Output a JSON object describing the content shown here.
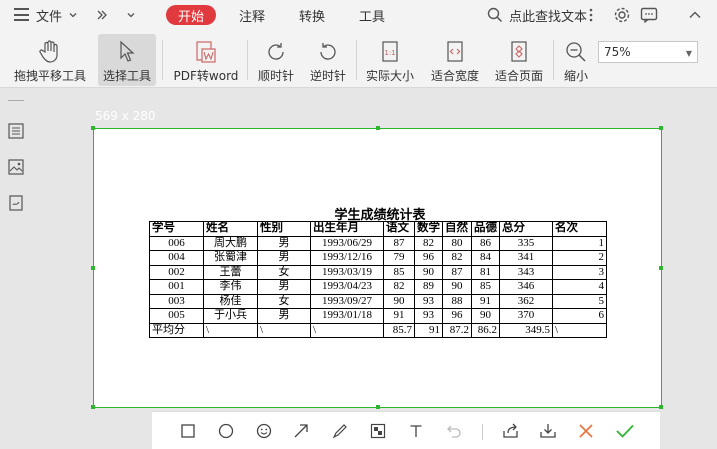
{
  "menubar": {
    "file": "文件",
    "tabs": [
      "开始",
      "注释",
      "转换",
      "工具"
    ],
    "search_label": "点此查找文本"
  },
  "ribbon": {
    "tools": [
      "拖拽平移工具",
      "选择工具",
      "PDF转word",
      "顺时针",
      "逆时针",
      "实际大小",
      "适合宽度",
      "适合页面",
      "缩小"
    ],
    "zoom_value": "75%"
  },
  "selection": {
    "size_label": "569 x 280"
  },
  "document": {
    "title": "学生成绩统计表",
    "headers": [
      "学号",
      "姓名",
      "性别",
      "出生年月",
      "语文",
      "数学",
      "自然",
      "品德",
      "总分",
      "名次"
    ],
    "rows": [
      [
        "006",
        "周大鹏",
        "男",
        "1993/06/29",
        "87",
        "82",
        "80",
        "86",
        "335",
        "1"
      ],
      [
        "004",
        "张蜀津",
        "男",
        "1993/12/16",
        "79",
        "96",
        "82",
        "84",
        "341",
        "2"
      ],
      [
        "002",
        "王蕾",
        "女",
        "1993/03/19",
        "85",
        "90",
        "87",
        "81",
        "343",
        "3"
      ],
      [
        "001",
        "李伟",
        "男",
        "1993/04/23",
        "82",
        "89",
        "90",
        "85",
        "346",
        "4"
      ],
      [
        "003",
        "杨佳",
        "女",
        "1993/09/27",
        "90",
        "93",
        "88",
        "91",
        "362",
        "5"
      ],
      [
        "005",
        "于小兵",
        "男",
        "1993/01/18",
        "91",
        "93",
        "96",
        "90",
        "370",
        "6"
      ]
    ],
    "footer": [
      "平均分",
      "\\",
      "\\",
      "\\",
      "85.7",
      "91",
      "87.2",
      "86.2",
      "349.5",
      "\\"
    ]
  },
  "colors": {
    "accent": "#e0393e",
    "selection": "#2fb62f",
    "confirm": "#2fb62f",
    "cancel": "#e8703a"
  }
}
